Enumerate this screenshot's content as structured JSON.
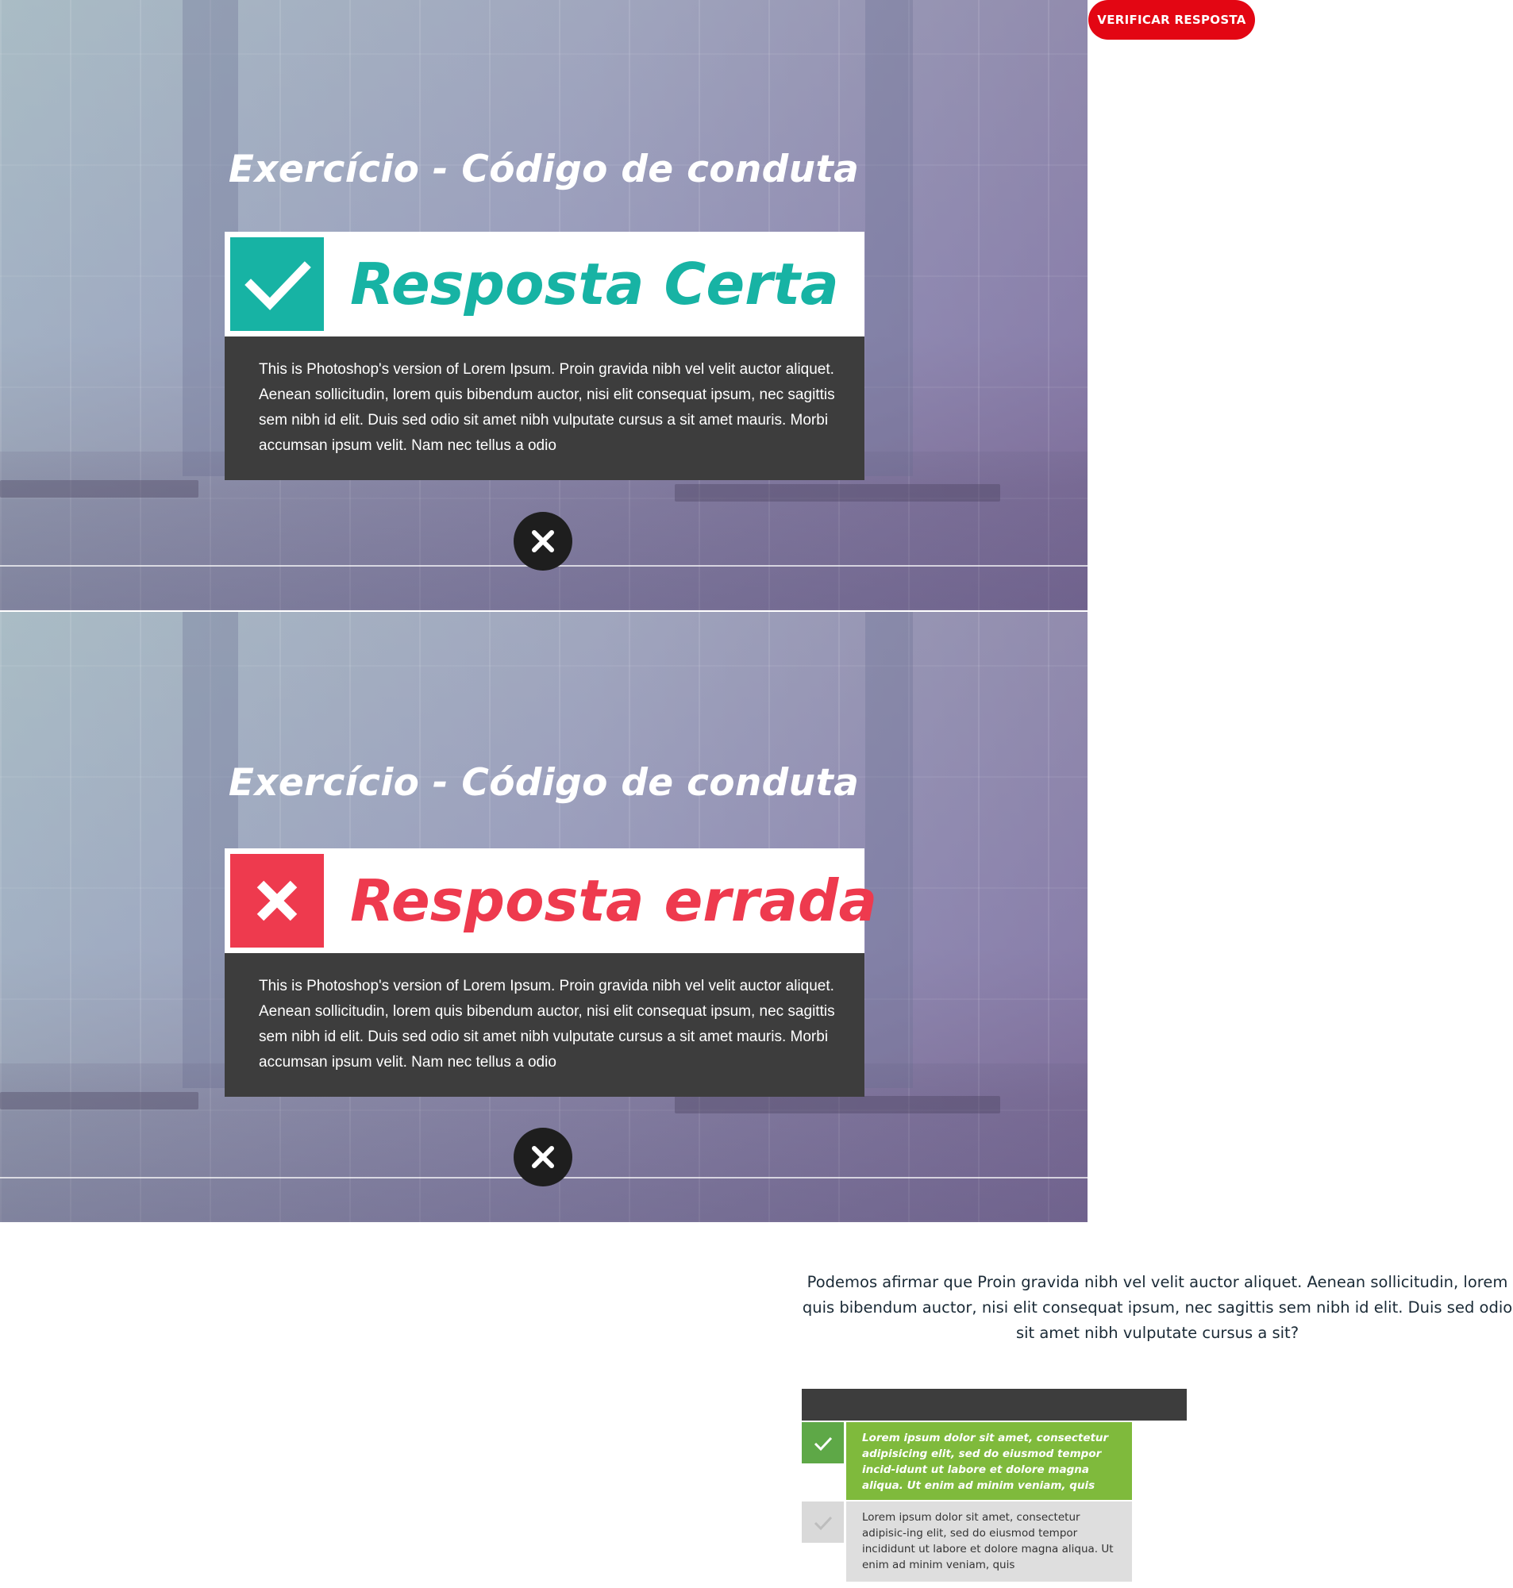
{
  "verify_button": {
    "label": "VERIFICAR RESPOSTA"
  },
  "panels": [
    {
      "title": "Exercício - Código de conduta",
      "result": {
        "label": "Resposta Certa",
        "status": "correct",
        "color": "#17b3a4",
        "icon": "check-icon"
      },
      "feedback": "This is Photoshop's version  of Lorem Ipsum. Proin gravida nibh vel velit auctor aliquet. Aenean sollicitudin, lorem quis bibendum auctor, nisi elit consequat ipsum, nec sagittis sem nibh id elit. Duis sed odio sit amet nibh vulputate cursus a sit amet mauris. Morbi accumsan ipsum velit. Nam nec tellus a odio",
      "close_icon": "close-icon"
    },
    {
      "title": "Exercício - Código de conduta",
      "result": {
        "label": "Resposta errada",
        "status": "wrong",
        "color": "#ee3a4e",
        "icon": "close-icon"
      },
      "feedback": "This is Photoshop's version  of Lorem Ipsum. Proin gravida nibh vel velit auctor aliquet. Aenean sollicitudin, lorem quis bibendum auctor, nisi elit consequat ipsum, nec sagittis sem nibh id elit. Duis sed odio sit amet nibh vulputate cursus a sit amet mauris. Morbi accumsan ipsum velit. Nam nec tellus a odio",
      "close_icon": "close-icon"
    }
  ],
  "question": {
    "text": "Podemos afirmar que Proin gravida nibh vel velit auctor aliquet. Aenean sollicitudin, lorem quis bibendum auctor, nisi elit consequat ipsum, nec sagittis sem nibh id elit. Duis sed odio sit amet nibh vulputate cursus a sit?",
    "options": [
      {
        "text": "Lorem ipsum dolor sit amet, consectetur adipisicing elit, sed do eiusmod tempor incid-idunt ut labore et dolore magna aliqua. Ut enim ad minim veniam, quis",
        "selected": true,
        "color": "#7fba3c"
      },
      {
        "text": "Lorem ipsum dolor sit amet, consectetur adipisic-ing elit, sed do eiusmod tempor incididunt ut labore et dolore magna aliqua. Ut enim ad minim veniam, quis",
        "selected": false,
        "color": "#dedede"
      }
    ]
  },
  "colors": {
    "accent_red": "#e30613",
    "dark_box": "#3d3d3d",
    "correct": "#17b3a4",
    "wrong": "#ee3a4e"
  }
}
